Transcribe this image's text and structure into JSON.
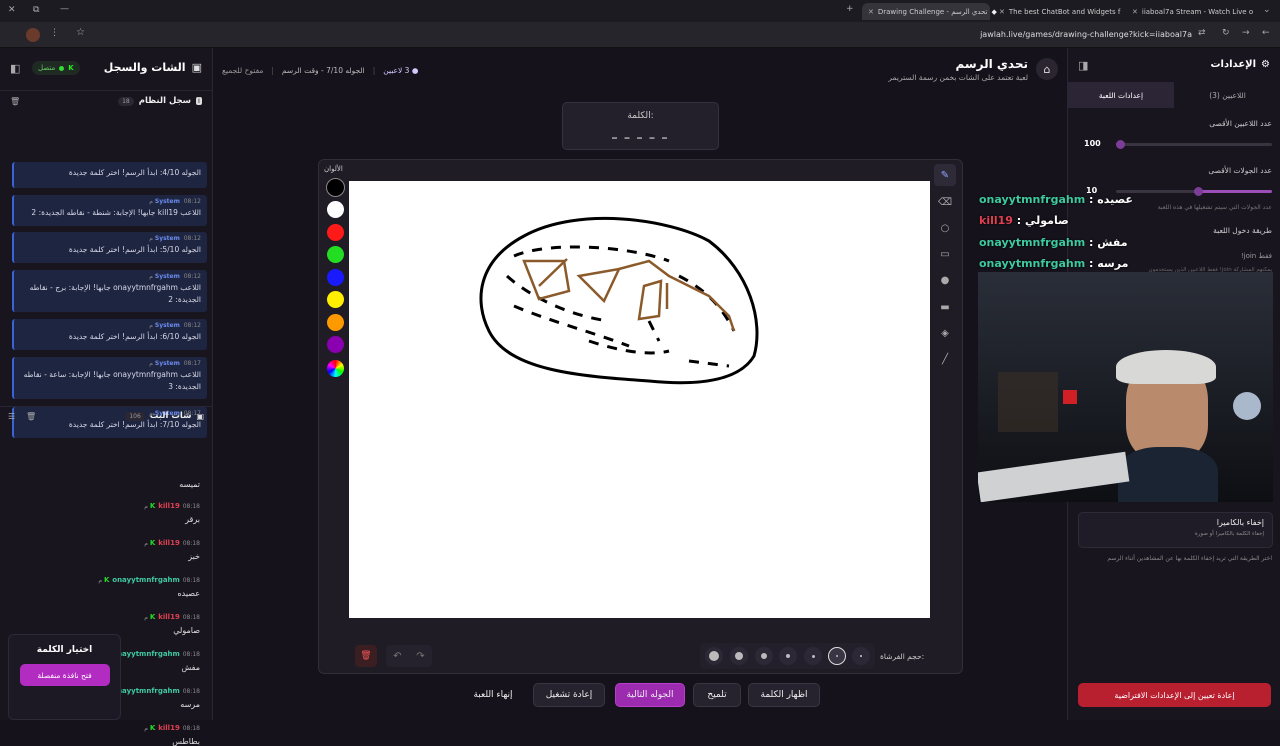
{
  "browser": {
    "tabs": [
      {
        "label": "Drawing Challenge - تحدي الرسم"
      },
      {
        "label": "The best ChatBot and Widgets f"
      },
      {
        "label": "iiaboal7a Stream - Watch Live o"
      }
    ],
    "url": "jawlah.live/games/drawing-challenge?kick=iiaboal7a"
  },
  "left": {
    "title": "الشات والسجل",
    "status": "متصل",
    "system_log": {
      "title": "سجل النظام",
      "count": "18",
      "entries": [
        {
          "sender": "",
          "time": "",
          "message": "الجوله 4/10: ابدأ الرسم! اختر كلمة جديدة"
        },
        {
          "sender": "System",
          "time": "08:12 م",
          "message": "اللاعب kill19 جابها! الإجابة: شنطة - نقاطه الجديدة: 2"
        },
        {
          "sender": "System",
          "time": "08:12 م",
          "message": "الجوله 5/10: ابدأ الرسم! اختر كلمة جديدة"
        },
        {
          "sender": "System",
          "time": "08:12 م",
          "message": "اللاعب onayytmnfrgahm جابها! الإجابة: برج - نقاطه الجديدة: 2"
        },
        {
          "sender": "System",
          "time": "08:12 م",
          "message": "الجوله 6/10: ابدأ الرسم! اختر كلمة جديدة"
        },
        {
          "sender": "System",
          "time": "08:17 م",
          "message": "اللاعب onayytmnfrgahm جابها! الإجابة: ساعة - نقاطه الجديدة: 3"
        },
        {
          "sender": "System",
          "time": "08:17 م",
          "message": "الجوله 7/10: ابدأ الرسم! اختر كلمة جديدة"
        }
      ]
    },
    "live_chat": {
      "title": "شات البث",
      "count": "106",
      "messages": [
        {
          "user": "",
          "time": "",
          "text": "تميسه",
          "color": "#e04050"
        },
        {
          "user": "kill19",
          "time": "08:18 م",
          "text": "برقر",
          "color": "#e04050"
        },
        {
          "user": "kill19",
          "time": "08:18 م",
          "text": "خبز",
          "color": "#e04050"
        },
        {
          "user": "onayytmnfrgahm",
          "time": "08:18 م",
          "text": "عصيده",
          "color": "#3ec9a0"
        },
        {
          "user": "kill19",
          "time": "08:18 م",
          "text": "صامولي",
          "color": "#e04050"
        },
        {
          "user": "onayytmnfrgahm",
          "time": "08:18 م",
          "text": "مفش",
          "color": "#3ec9a0"
        },
        {
          "user": "onayytmnfrgahm",
          "time": "08:18 م",
          "text": "مرسه",
          "color": "#3ec9a0"
        },
        {
          "user": "kill19",
          "time": "08:18 م",
          "text": "بطاطس",
          "color": "#e04050"
        }
      ]
    },
    "word_choice": {
      "title": "اختيار الكلمة",
      "button": "فتح نافذة منفصلة"
    }
  },
  "header": {
    "title": "تحدي الرسم",
    "subtitle": "لعبة تعتمد على الشات بخمن رسمة الستريمر",
    "players": "3 لاعبين",
    "round": "الجوله 7/10 - وقت الرسم",
    "open": "مفتوح للجميع"
  },
  "word": {
    "label": "الكلمة:",
    "hint": "_ _ _ _ _"
  },
  "canvas": {
    "colors_label": "الألوان",
    "brush_label": "حجم الفرشاة:",
    "colors": [
      "#000000",
      "#ffffff",
      "#ff1a1a",
      "#22dd22",
      "#1a1aff",
      "#ffee00",
      "#ff9900",
      "#8a00b0"
    ]
  },
  "actions": {
    "end": "إنهاء اللعبة",
    "restart": "إعادة تشغيل",
    "next": "الجوله التالية",
    "hint": "تلميح",
    "reveal": "اظهار الكلمة"
  },
  "settings": {
    "title": "الإعدادات",
    "tab_players": "اللاعبين (3)",
    "tab_game": "إعدادات اللعبة",
    "max_players_label": "عدد اللاعبين الأقصى",
    "max_players_value": "100",
    "max_players_fraction": 0.0,
    "max_rounds_label": "عدد الجولات الأقصى",
    "max_rounds_value": "10",
    "max_rounds_fraction": 0.5,
    "rounds_note": "عدد الجولات التي سيتم تشغيلها في هذه اللعبة",
    "join_label": "طريقة دخول اللعبة",
    "join_value": "!join فقط",
    "join_note": "فقط اللاعبين الذين يستخدمون !join يمكنهم المشاركة",
    "hide_title": "إخفاء بالكاميرا",
    "hide_sub": "إخفاء الكلمة بالكاميرا أو صورة",
    "hide_note": "اختر الطريقة التي تريد إخفاء الكلمة بها عن المشاهدين أثناء الرسم",
    "reset": "إعادة تعيين إلى الإعدادات الافتراضية"
  },
  "overlay": [
    {
      "user": "onayytmnfrgahm",
      "text": "عصيده",
      "color": "#3ec9a0"
    },
    {
      "user": "kill19",
      "text": "صامولي",
      "color": "#e04050"
    },
    {
      "user": "onayytmnfrgahm",
      "text": "مفش",
      "color": "#3ec9a0"
    },
    {
      "user": "onayytmnfrgahm",
      "text": "مرسه",
      "color": "#3ec9a0"
    }
  ]
}
